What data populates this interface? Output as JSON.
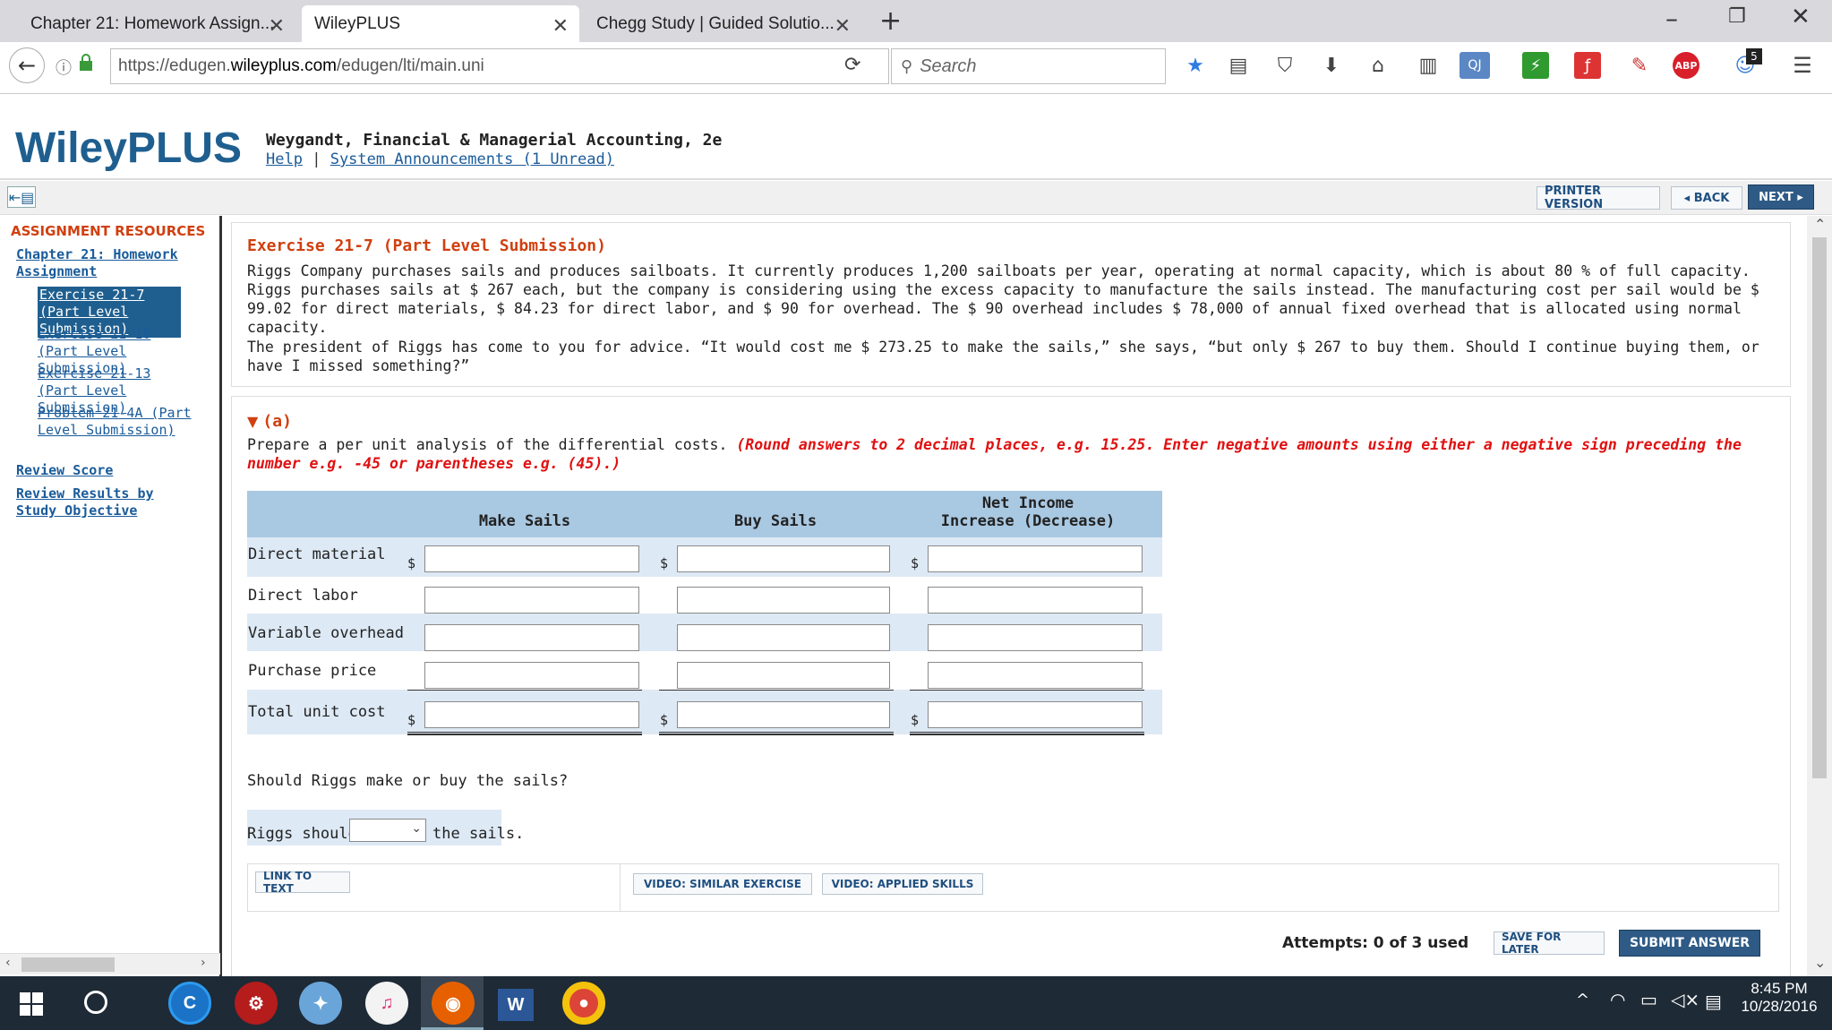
{
  "browser": {
    "tabs": [
      {
        "label": "Chapter 21: Homework Assign...",
        "active": false
      },
      {
        "label": "WileyPLUS",
        "active": true
      },
      {
        "label": "Chegg Study | Guided Solutio...",
        "active": false
      }
    ],
    "new_tab_label": "+",
    "url_prefix": "https://edugen.",
    "url_domain": "wileyplus.com",
    "url_path": "/edugen/lti/main.uni",
    "search_placeholder": "Search",
    "badge_count": "5",
    "abp_label": "ABP"
  },
  "header": {
    "logo": "WileyPLUS",
    "book_title": "Weygandt, Financial & Managerial Accounting, 2e",
    "help_link": "Help",
    "separator": "|",
    "announcements_link": "System Announcements (1 Unread)"
  },
  "toolbar": {
    "printer_version": "PRINTER VERSION",
    "back": "◂ BACK",
    "next": "NEXT ▸"
  },
  "sidebar": {
    "heading": "ASSIGNMENT RESOURCES",
    "chapter_link": "Chapter 21: Homework Assignment",
    "items": [
      {
        "label": "Exercise 21-7 (Part Level Submission)",
        "selected": true
      },
      {
        "label": "Exercise 21-10 (Part Level Submission)",
        "selected": false
      },
      {
        "label": "Exercise 21-13 (Part Level Submission)",
        "selected": false
      },
      {
        "label": "Problem 21-4A (Part Level Submission)",
        "selected": false
      }
    ],
    "review_score": "Review Score",
    "review_results": "Review Results by Study Objective"
  },
  "exercise": {
    "title": "Exercise 21-7 (Part Level Submission)",
    "paragraph1": "Riggs Company purchases sails and produces sailboats. It currently produces 1,200 sailboats per year, operating at normal capacity, which is about 80 % of full capacity. Riggs purchases sails at $ 267 each, but the company is considering using the excess capacity to manufacture the sails instead. The manufacturing cost per sail would be $ 99.02 for direct materials, $ 84.23 for direct labor, and $ 90 for overhead. The $ 90 overhead includes $ 78,000 of annual fixed overhead that is allocated using normal capacity.",
    "paragraph2": "The president of Riggs has come to you for advice. “It would cost me $ 273.25 to make the sails,” she says, “but only $ 267 to buy them. Should I continue buying them, or have I missed something?”",
    "part_label": "(a)",
    "instruction": "Prepare a per unit analysis of the differential costs. ",
    "hint": "(Round answers to 2 decimal places, e.g. 15.25. Enter negative amounts using either a negative sign preceding the number e.g. -45 or parentheses e.g. (45).)",
    "table": {
      "col1": "Make Sails",
      "col2": "Buy Sails",
      "col3_line1": "Net Income",
      "col3_line2": "Increase (Decrease)",
      "rows": [
        "Direct material",
        "Direct labor",
        "Variable overhead",
        "Purchase price",
        "Total unit cost"
      ],
      "dollar": "$"
    },
    "question": "Should Riggs make or buy the sails?",
    "riggs_should": "Riggs should",
    "select_value": "",
    "the_sails": "the sails."
  },
  "actions": {
    "link_to_text": "LINK TO TEXT",
    "video_similar": "VIDEO: SIMILAR EXERCISE",
    "video_applied": "VIDEO: APPLIED SKILLS",
    "attempts": "Attempts: 0 of 3 used",
    "save_for_later": "SAVE FOR LATER",
    "submit_answer": "SUBMIT ANSWER"
  },
  "taskbar": {
    "time": "8:45 PM",
    "date": "10/28/2016"
  }
}
